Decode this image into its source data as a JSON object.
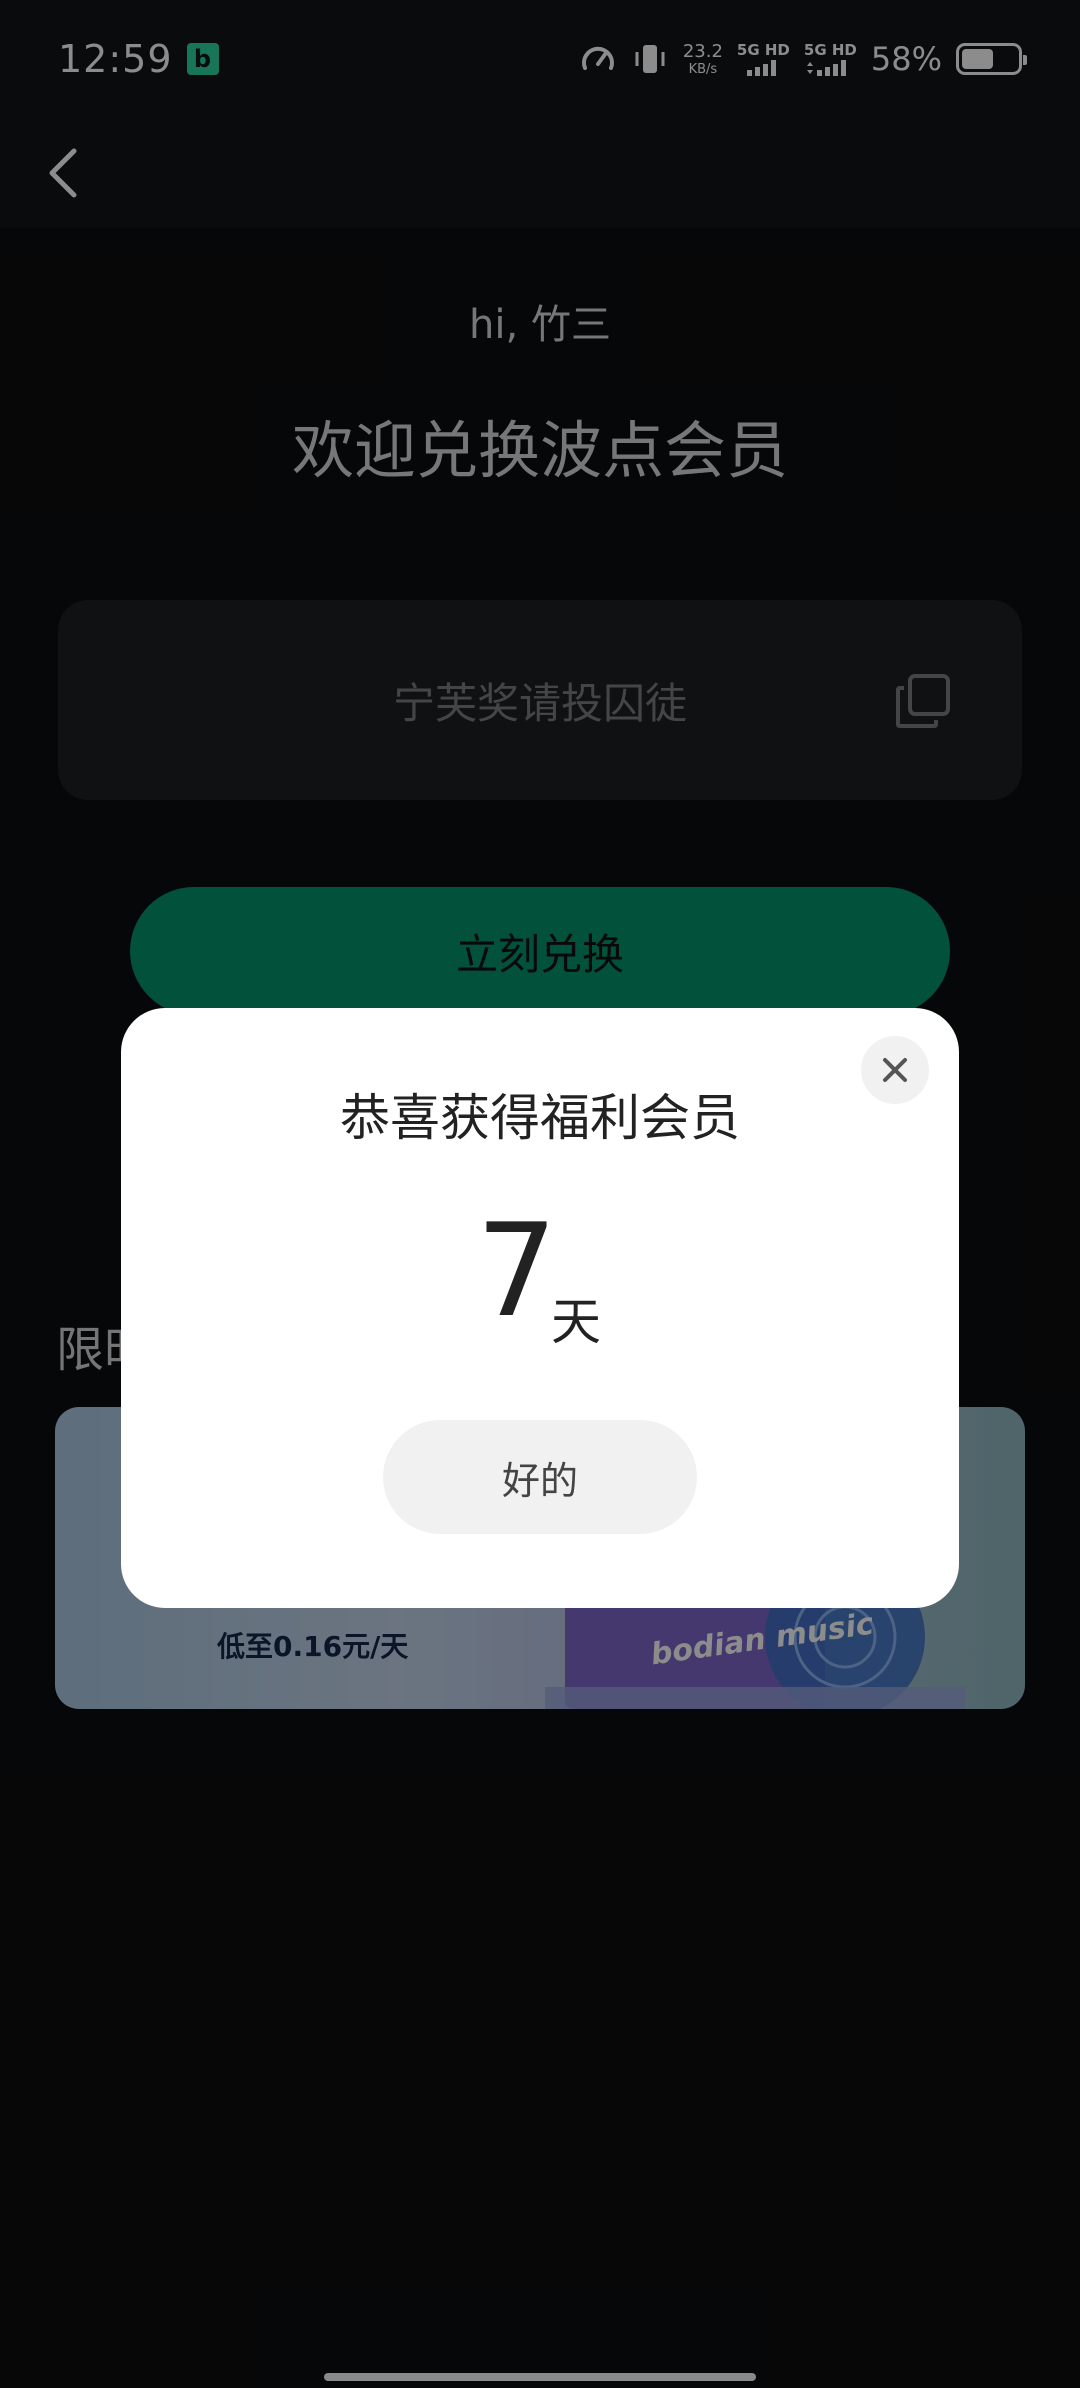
{
  "status_bar": {
    "time": "12:59",
    "app_badge": "b",
    "net_speed_value": "23.2",
    "net_speed_unit": "KB/s",
    "sim1_label": "5G HD",
    "sim2_label": "5G HD",
    "battery_percent": "58%",
    "battery_level": 0.58
  },
  "header": {
    "greeting": "hi, 竹三",
    "title": "欢迎兑换波点会员"
  },
  "redeem": {
    "code_text": "宁芙奖请投囚徒",
    "button_label": "立刻兑换"
  },
  "promo": {
    "heading": "限时",
    "price_text": "低至0.16元/天",
    "logo_text": "bodian music"
  },
  "dialog": {
    "title": "恭喜获得福利会员",
    "days": "7",
    "unit": "天",
    "ok_label": "好的"
  },
  "colors": {
    "accent": "#04946a",
    "background": "#0c0d0f",
    "dialog_bg": "#ffffff"
  },
  "icons": {
    "back": "chevron-left-icon",
    "copy": "copy-icon",
    "close": "close-icon"
  }
}
